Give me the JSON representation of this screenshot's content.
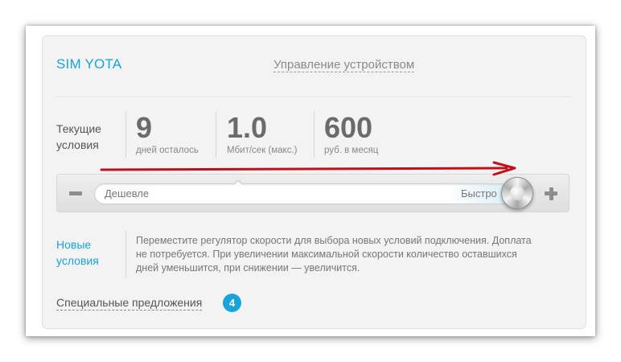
{
  "header": {
    "title": "SIM YOTA",
    "manage_link": "Управление устройством"
  },
  "current": {
    "label": "Текущие условия",
    "metrics": [
      {
        "value": "9",
        "unit": "дней осталось"
      },
      {
        "value": "1.0",
        "unit": "Мбит/сек (макс.)"
      },
      {
        "value": "600",
        "unit": "руб. в месяц"
      }
    ]
  },
  "slider": {
    "min_label": "Дешевле",
    "max_label": "Быстро",
    "position": 1.0,
    "annotation_arrow_color": "#c0101a"
  },
  "new_conditions": {
    "label": "Новые условия",
    "description": "Переместите регулятор скорости для выбора новых условий подключения. Доплата не потребуется. При увеличении максимальной скорости количество оставшихся дней уменьшится, при снижении — увеличится."
  },
  "special_offers": {
    "label": "Специальные предложения",
    "count": "4"
  },
  "colors": {
    "accent": "#1aa3d9",
    "metric_text": "#6b6b6b",
    "card_bg": "#f3f3f3"
  },
  "icons": {
    "minus": "minus-icon",
    "plus": "plus-icon"
  }
}
